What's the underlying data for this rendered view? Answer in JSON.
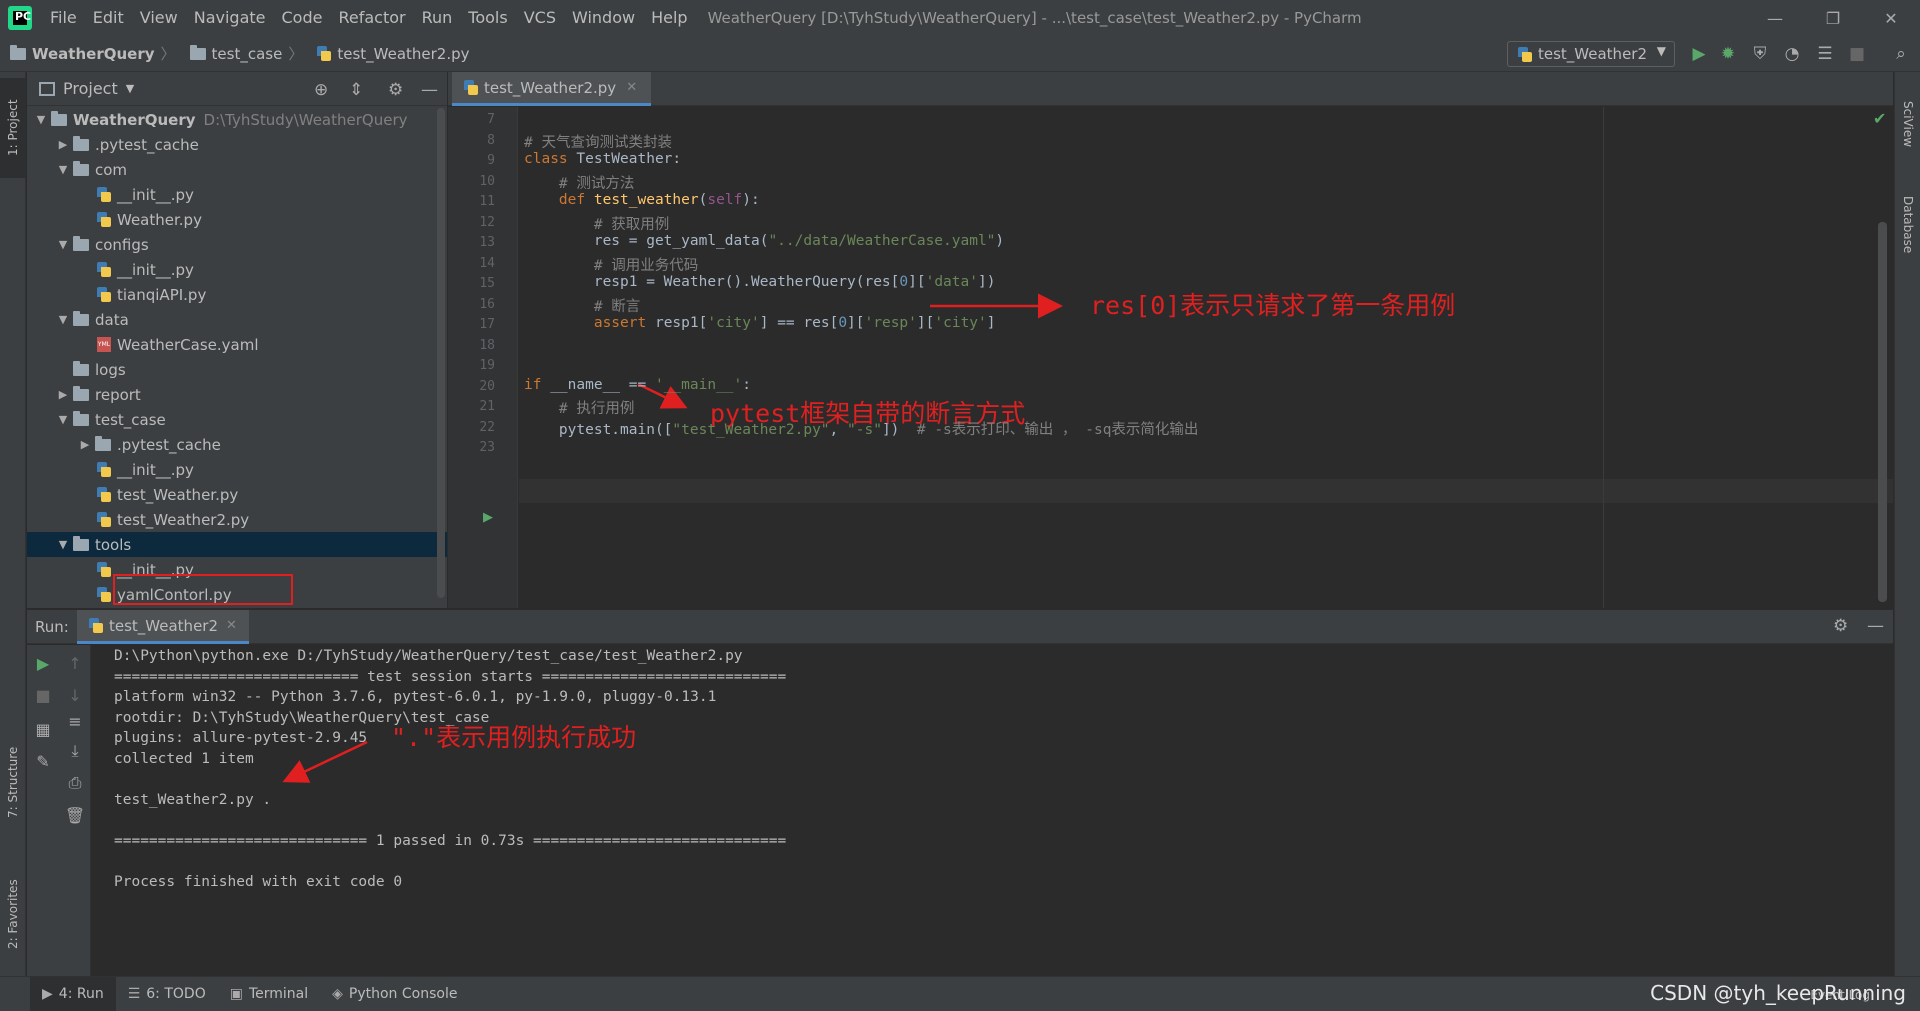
{
  "menu": [
    "File",
    "Edit",
    "View",
    "Navigate",
    "Code",
    "Refactor",
    "Run",
    "Tools",
    "VCS",
    "Window",
    "Help"
  ],
  "window_title": "WeatherQuery [D:\\TyhStudy\\WeatherQuery] - ...\\test_case\\test_Weather2.py - PyCharm",
  "logo_text": "PC",
  "breadcrumbs": [
    "WeatherQuery",
    "test_case",
    "test_Weather2.py"
  ],
  "run_config": "test_Weather2",
  "project_panel": {
    "title": "Project",
    "tree": [
      {
        "label": "WeatherQuery",
        "path": "D:\\TyhStudy\\WeatherQuery",
        "indent": 0,
        "type": "folder",
        "expanded": true
      },
      {
        "label": ".pytest_cache",
        "indent": 1,
        "type": "folder",
        "expanded": false
      },
      {
        "label": "com",
        "indent": 1,
        "type": "folder",
        "expanded": true
      },
      {
        "label": "__init__.py",
        "indent": 2,
        "type": "py"
      },
      {
        "label": "Weather.py",
        "indent": 2,
        "type": "py"
      },
      {
        "label": "configs",
        "indent": 1,
        "type": "folder",
        "expanded": true
      },
      {
        "label": "__init__.py",
        "indent": 2,
        "type": "py"
      },
      {
        "label": "tianqiAPI.py",
        "indent": 2,
        "type": "py"
      },
      {
        "label": "data",
        "indent": 1,
        "type": "folder",
        "expanded": true
      },
      {
        "label": "WeatherCase.yaml",
        "indent": 2,
        "type": "yaml"
      },
      {
        "label": "logs",
        "indent": 1,
        "type": "folder",
        "expanded": null
      },
      {
        "label": "report",
        "indent": 1,
        "type": "folder",
        "expanded": false
      },
      {
        "label": "test_case",
        "indent": 1,
        "type": "folder",
        "expanded": true
      },
      {
        "label": ".pytest_cache",
        "indent": 2,
        "type": "folder",
        "expanded": false
      },
      {
        "label": "__init__.py",
        "indent": 2,
        "type": "py"
      },
      {
        "label": "test_Weather.py",
        "indent": 2,
        "type": "py"
      },
      {
        "label": "test_Weather2.py",
        "indent": 2,
        "type": "py"
      },
      {
        "label": "tools",
        "indent": 1,
        "type": "folder",
        "expanded": true,
        "selected": true
      },
      {
        "label": "__init__.py",
        "indent": 2,
        "type": "py"
      },
      {
        "label": "yamlContorl.py",
        "indent": 2,
        "type": "py"
      }
    ]
  },
  "editor": {
    "tab": "test_Weather2.py",
    "lines": [
      {
        "n": "7",
        "html": ""
      },
      {
        "n": "8",
        "html": "<span class='cm'># 天气查询测试类封装</span>"
      },
      {
        "n": "9",
        "html": "<span class='kw'>class</span> TestWeather:"
      },
      {
        "n": "10",
        "html": "    <span class='cm'># 测试方法</span>"
      },
      {
        "n": "11",
        "html": "    <span class='kw'>def</span> <span class='fn'>test_weather</span>(<span class='self'>self</span>):"
      },
      {
        "n": "12",
        "html": "        <span class='cm'># 获取用例</span>"
      },
      {
        "n": "13",
        "html": "        res = get_yaml_data(<span class='str'>\"../data/WeatherCase.yaml\"</span>)"
      },
      {
        "n": "14",
        "html": "        <span class='cm'># 调用业务代码</span>"
      },
      {
        "n": "15",
        "html": "        resp1 = Weather().WeatherQuery(res[<span class='nm'>0</span>][<span class='str'>'data'</span>])"
      },
      {
        "n": "16",
        "html": "        <span class='cm'># 断言</span>"
      },
      {
        "n": "17",
        "html": "        <span class='kw'>assert</span> resp1[<span class='str'>'city'</span>] == res[<span class='nm'>0</span>][<span class='str'>'resp'</span>][<span class='str'>'city'</span>]"
      },
      {
        "n": "18",
        "html": ""
      },
      {
        "n": "19",
        "html": ""
      },
      {
        "n": "20",
        "html": "<span class='kw'>if</span> __name__ == <span class='str'>'__main__'</span>:"
      },
      {
        "n": "21",
        "html": "    <span class='cm'># 执行用例</span>"
      },
      {
        "n": "22",
        "html": "    pytest.main([<span class='str'>\"test_Weather2.py\"</span>, <span class='str'>\"-s\"</span>])  <span class='cm'># -s表示打印、输出 ， -sq表示简化输出</span>"
      },
      {
        "n": "23",
        "html": ""
      }
    ],
    "annotations": {
      "res_note": "res[0]表示只请求了第一条用例",
      "assert_note": "pytest框架自带的断言方式"
    }
  },
  "run_panel": {
    "label": "Run:",
    "tab": "test_Weather2",
    "console": [
      "D:\\Python\\python.exe D:/TyhStudy/WeatherQuery/test_case/test_Weather2.py",
      "============================ test session starts ============================",
      "platform win32 -- Python 3.7.6, pytest-6.0.1, py-1.9.0, pluggy-0.13.1",
      "rootdir: D:\\TyhStudy\\WeatherQuery\\test_case",
      "plugins: allure-pytest-2.9.45",
      "collected 1 item",
      "",
      "test_Weather2.py .",
      "",
      "============================= 1 passed in 0.73s =============================",
      "",
      "Process finished with exit code 0"
    ],
    "annotation": "\".\"表示用例执行成功"
  },
  "left_strip": [
    "1: Project",
    "7: Structure",
    "2: Favorites"
  ],
  "right_strip": [
    "SciView",
    "Database"
  ],
  "statusbar": {
    "tabs": [
      "4: Run",
      "6: TODO",
      "Terminal",
      "Python Console"
    ],
    "event_log": "Event Log",
    "watermark": "CSDN @tyh_keepRunning"
  }
}
